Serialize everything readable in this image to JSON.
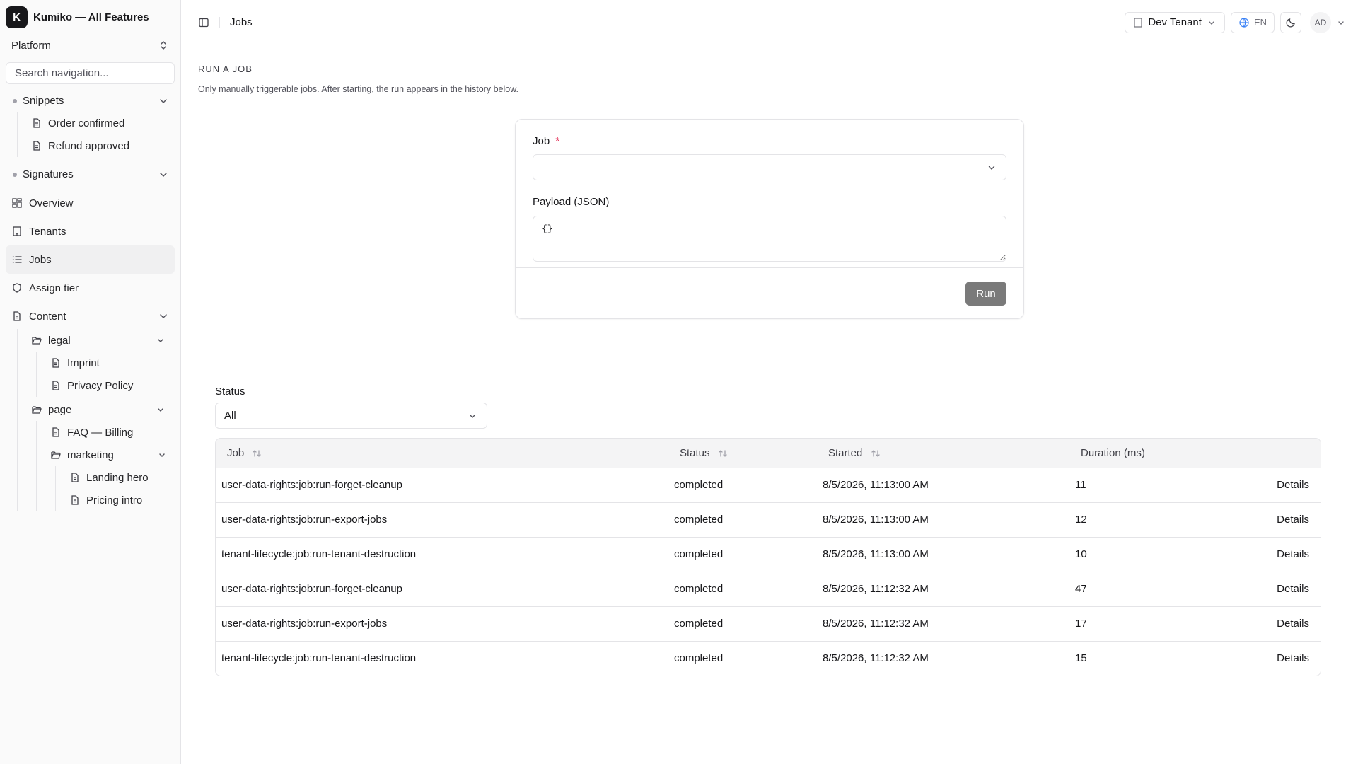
{
  "brand": {
    "logo_letter": "K",
    "name": "Kumiko — All Features"
  },
  "sidebar": {
    "platform_label": "Platform",
    "search_placeholder": "Search navigation...",
    "snippets": {
      "label": "Snippets",
      "items": [
        "Order confirmed",
        "Refund approved"
      ]
    },
    "signatures": {
      "label": "Signatures"
    },
    "items": [
      {
        "label": "Overview",
        "icon": "dashboard-icon"
      },
      {
        "label": "Tenants",
        "icon": "building-icon"
      },
      {
        "label": "Jobs",
        "icon": "list-icon",
        "active": true
      },
      {
        "label": "Assign tier",
        "icon": "shield-icon"
      },
      {
        "label": "Content",
        "icon": "document-icon"
      }
    ],
    "content_tree": {
      "legal": {
        "label": "legal",
        "items": [
          "Imprint",
          "Privacy Policy"
        ]
      },
      "page": {
        "label": "page",
        "items": [
          "FAQ — Billing"
        ]
      },
      "marketing": {
        "label": "marketing",
        "items": [
          "Landing hero",
          "Pricing intro"
        ]
      }
    }
  },
  "topbar": {
    "breadcrumb": "Jobs",
    "tenant": "Dev Tenant",
    "language": "EN",
    "avatar_initials": "AD"
  },
  "run_section": {
    "title": "RUN A JOB",
    "description": "Only manually triggerable jobs. After starting, the run appears in the history below.",
    "job_label": "Job",
    "required_mark": "*",
    "job_value": "",
    "payload_label": "Payload (JSON)",
    "payload_value": "{}",
    "run_button": "Run",
    "run_button_color": "#7a7a7a"
  },
  "filter": {
    "label": "Status",
    "value": "All"
  },
  "table": {
    "headers": [
      "Job",
      "Status",
      "Started",
      "Duration (ms)"
    ],
    "action_label": "Details",
    "rows": [
      {
        "job": "user-data-rights:job:run-forget-cleanup",
        "status": "completed",
        "started": "8/5/2026, 11:13:00 AM",
        "duration": "11"
      },
      {
        "job": "user-data-rights:job:run-export-jobs",
        "status": "completed",
        "started": "8/5/2026, 11:13:00 AM",
        "duration": "12"
      },
      {
        "job": "tenant-lifecycle:job:run-tenant-destruction",
        "status": "completed",
        "started": "8/5/2026, 11:13:00 AM",
        "duration": "10"
      },
      {
        "job": "user-data-rights:job:run-forget-cleanup",
        "status": "completed",
        "started": "8/5/2026, 11:12:32 AM",
        "duration": "47"
      },
      {
        "job": "user-data-rights:job:run-export-jobs",
        "status": "completed",
        "started": "8/5/2026, 11:12:32 AM",
        "duration": "17"
      },
      {
        "job": "tenant-lifecycle:job:run-tenant-destruction",
        "status": "completed",
        "started": "8/5/2026, 11:12:32 AM",
        "duration": "15"
      }
    ]
  }
}
